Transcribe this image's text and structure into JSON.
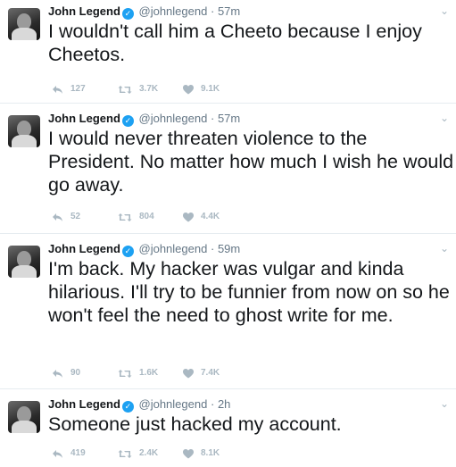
{
  "author": {
    "name": "John Legend",
    "handle": "@johnlegend",
    "verified_icon": "verified-check-icon"
  },
  "tweets": [
    {
      "time": "57m",
      "text": "I wouldn't call him a Cheeto because I enjoy Cheetos.",
      "replies": "127",
      "retweets": "3.7K",
      "likes": "9.1K"
    },
    {
      "time": "57m",
      "text": "I would never threaten violence to the President.  No matter how much I wish he would go away.",
      "replies": "52",
      "retweets": "804",
      "likes": "4.4K"
    },
    {
      "time": "59m",
      "text": "I'm back.  My hacker was vulgar and kinda hilarious.  I'll try to be funnier from now on so he won't feel the need to ghost write for me.",
      "replies": "90",
      "retweets": "1.6K",
      "likes": "7.4K"
    },
    {
      "time": "2h",
      "text": "Someone just hacked my account.",
      "replies": "419",
      "retweets": "2.4K",
      "likes": "8.1K"
    }
  ],
  "separator": "·",
  "colors": {
    "text": "#14171a",
    "secondary": "#657786",
    "action": "#aab8c2",
    "verified": "#1da1f2",
    "border": "#e6ecf0"
  }
}
